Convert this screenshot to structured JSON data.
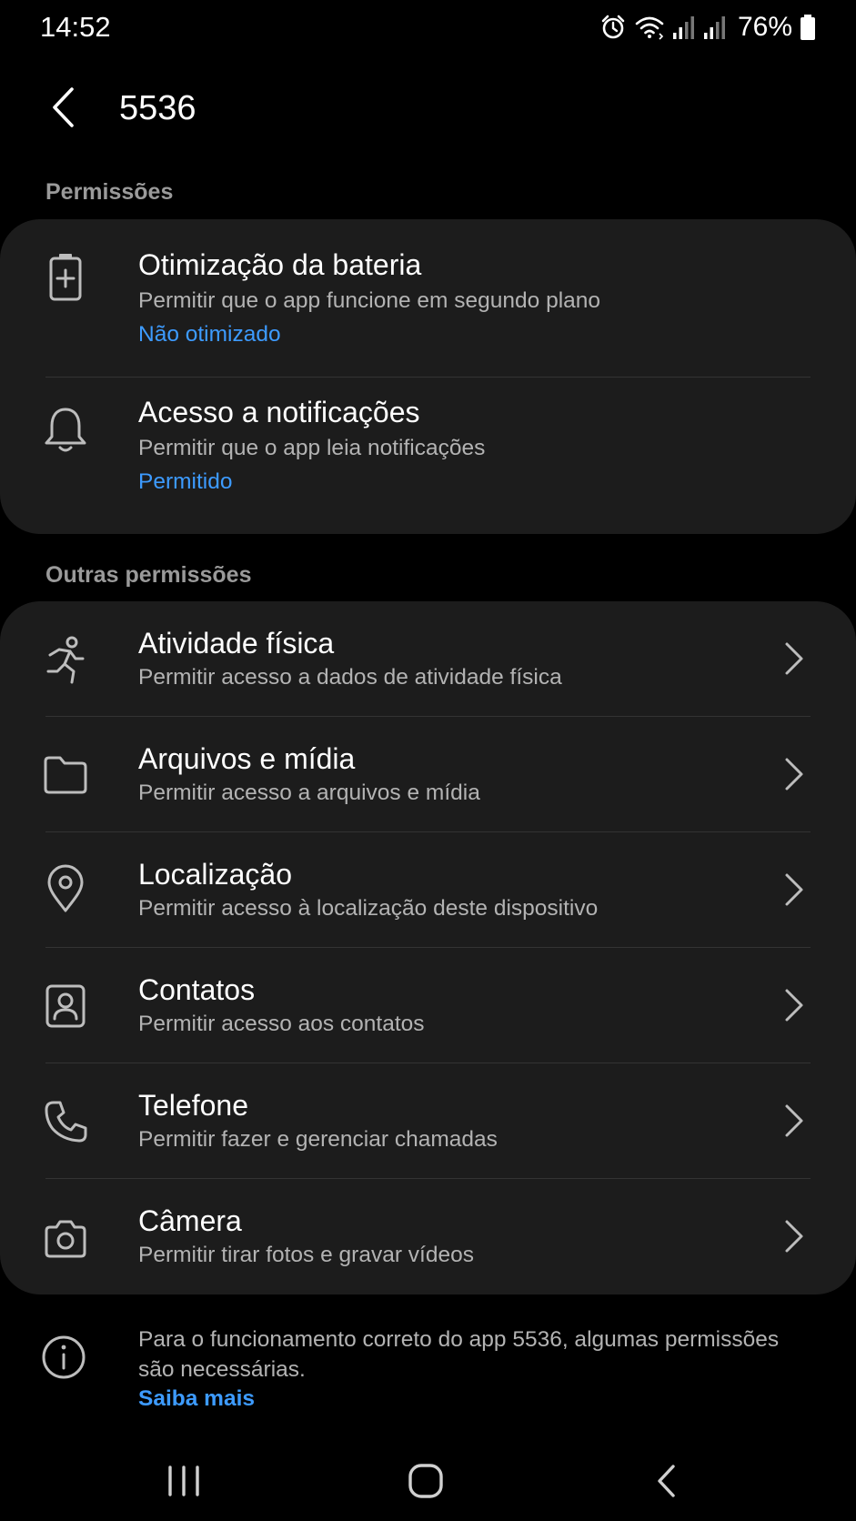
{
  "status_bar": {
    "time": "14:52",
    "battery_percent": "76%",
    "icons": [
      "alarm-icon",
      "wifi-icon",
      "signal-icon",
      "signal-icon",
      "battery-icon"
    ]
  },
  "app_bar": {
    "title": "5536",
    "back_icon": "back-arrow-icon"
  },
  "sections": {
    "permissions": {
      "header": "Permissões",
      "items": [
        {
          "icon": "battery-plus-icon",
          "title": "Otimização da bateria",
          "subtitle": "Permitir que o app funcione em segundo plano",
          "status": "Não otimizado"
        },
        {
          "icon": "bell-icon",
          "title": "Acesso a notificações",
          "subtitle": "Permitir que o app leia notificações",
          "status": "Permitido"
        }
      ]
    },
    "other_permissions": {
      "header": "Outras permissões",
      "items": [
        {
          "icon": "running-person-icon",
          "title": "Atividade física",
          "subtitle": "Permitir acesso a dados de atividade física"
        },
        {
          "icon": "folder-icon",
          "title": "Arquivos e mídia",
          "subtitle": "Permitir acesso a arquivos e mídia"
        },
        {
          "icon": "location-pin-icon",
          "title": "Localização",
          "subtitle": "Permitir acesso à localização deste dispositivo"
        },
        {
          "icon": "contact-card-icon",
          "title": "Contatos",
          "subtitle": "Permitir acesso aos contatos"
        },
        {
          "icon": "phone-icon",
          "title": "Telefone",
          "subtitle": "Permitir fazer e gerenciar chamadas"
        },
        {
          "icon": "camera-icon",
          "title": "Câmera",
          "subtitle": "Permitir tirar fotos e gravar vídeos"
        }
      ]
    }
  },
  "footer": {
    "icon": "info-icon",
    "text": "Para o funcionamento correto do app 5536, algumas permissões são necessárias.",
    "link": "Saiba mais"
  },
  "nav_bar": {
    "buttons": [
      "recents-icon",
      "home-icon",
      "back-icon"
    ]
  },
  "colors": {
    "background": "#000000",
    "card": "#1c1c1c",
    "accent": "#3d9bff",
    "secondary_text": "#b3b3b3",
    "section_header": "#9a9a9a"
  }
}
